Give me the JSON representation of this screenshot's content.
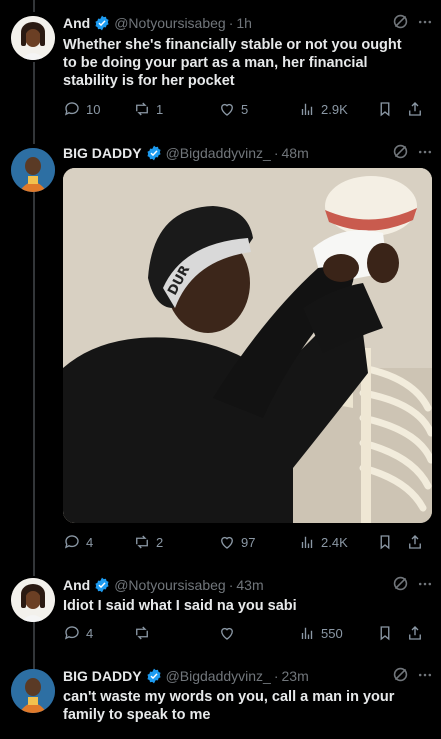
{
  "tweets": [
    {
      "name": "And",
      "handle": "@Notyoursisabeg",
      "time": "1h",
      "text": "Whether she's financially stable or not you ought to be doing your part as a man, her financial stability is for her pocket",
      "replies": "10",
      "reposts": "1",
      "likes": "5",
      "views": "2.9K"
    },
    {
      "name": "BIG DADDY",
      "handle": "@Bigdaddyvinz_",
      "time": "48m",
      "text": "",
      "replies": "4",
      "reposts": "2",
      "likes": "97",
      "views": "2.4K"
    },
    {
      "name": "And",
      "handle": "@Notyoursisabeg",
      "time": "43m",
      "text": "Idiot I said what I said na you sabi",
      "replies": "4",
      "reposts": "",
      "likes": "",
      "views": "550"
    },
    {
      "name": "BIG DADDY",
      "handle": "@Bigdaddyvinz_",
      "time": "23m",
      "text": "can't waste my words on you, call a man in your family to speak to me",
      "replies": "",
      "reposts": "",
      "likes": "",
      "views": ""
    }
  ],
  "media": {
    "headband_text": "DUR"
  },
  "colors": {
    "background": "#000000",
    "text": "#e7e9ea",
    "muted": "#71767b",
    "verified": "#1d9bf0"
  }
}
